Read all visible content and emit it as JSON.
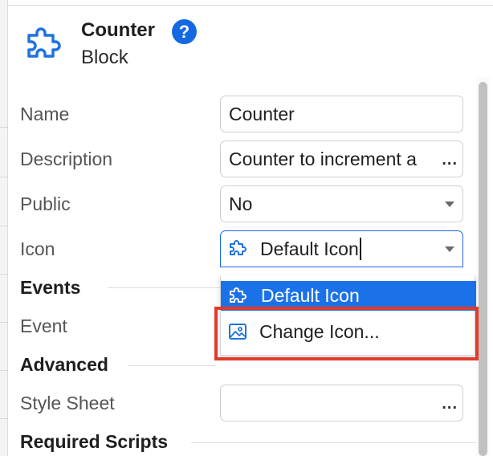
{
  "header": {
    "title": "Counter",
    "subtitle": "Block",
    "help_label": "?"
  },
  "form": {
    "name": {
      "label": "Name",
      "value": "Counter"
    },
    "description": {
      "label": "Description",
      "value": "Counter to increment a",
      "more": "..."
    },
    "public": {
      "label": "Public",
      "value": "No"
    },
    "icon": {
      "label": "Icon",
      "value": "Default Icon"
    }
  },
  "icon_dropdown": {
    "options": [
      {
        "label": "Default Icon",
        "icon": "puzzle-icon",
        "selected": true
      },
      {
        "label": "Change Icon...",
        "icon": "image-icon",
        "selected": false
      }
    ]
  },
  "sections": {
    "events": {
      "title": "Events",
      "event_label": "Event"
    },
    "advanced": {
      "title": "Advanced",
      "style_sheet_label": "Style Sheet",
      "style_sheet_more": "..."
    },
    "required_scripts": {
      "title": "Required Scripts"
    }
  },
  "colors": {
    "accent": "#1b72e8",
    "highlight": "#e23a2a"
  }
}
